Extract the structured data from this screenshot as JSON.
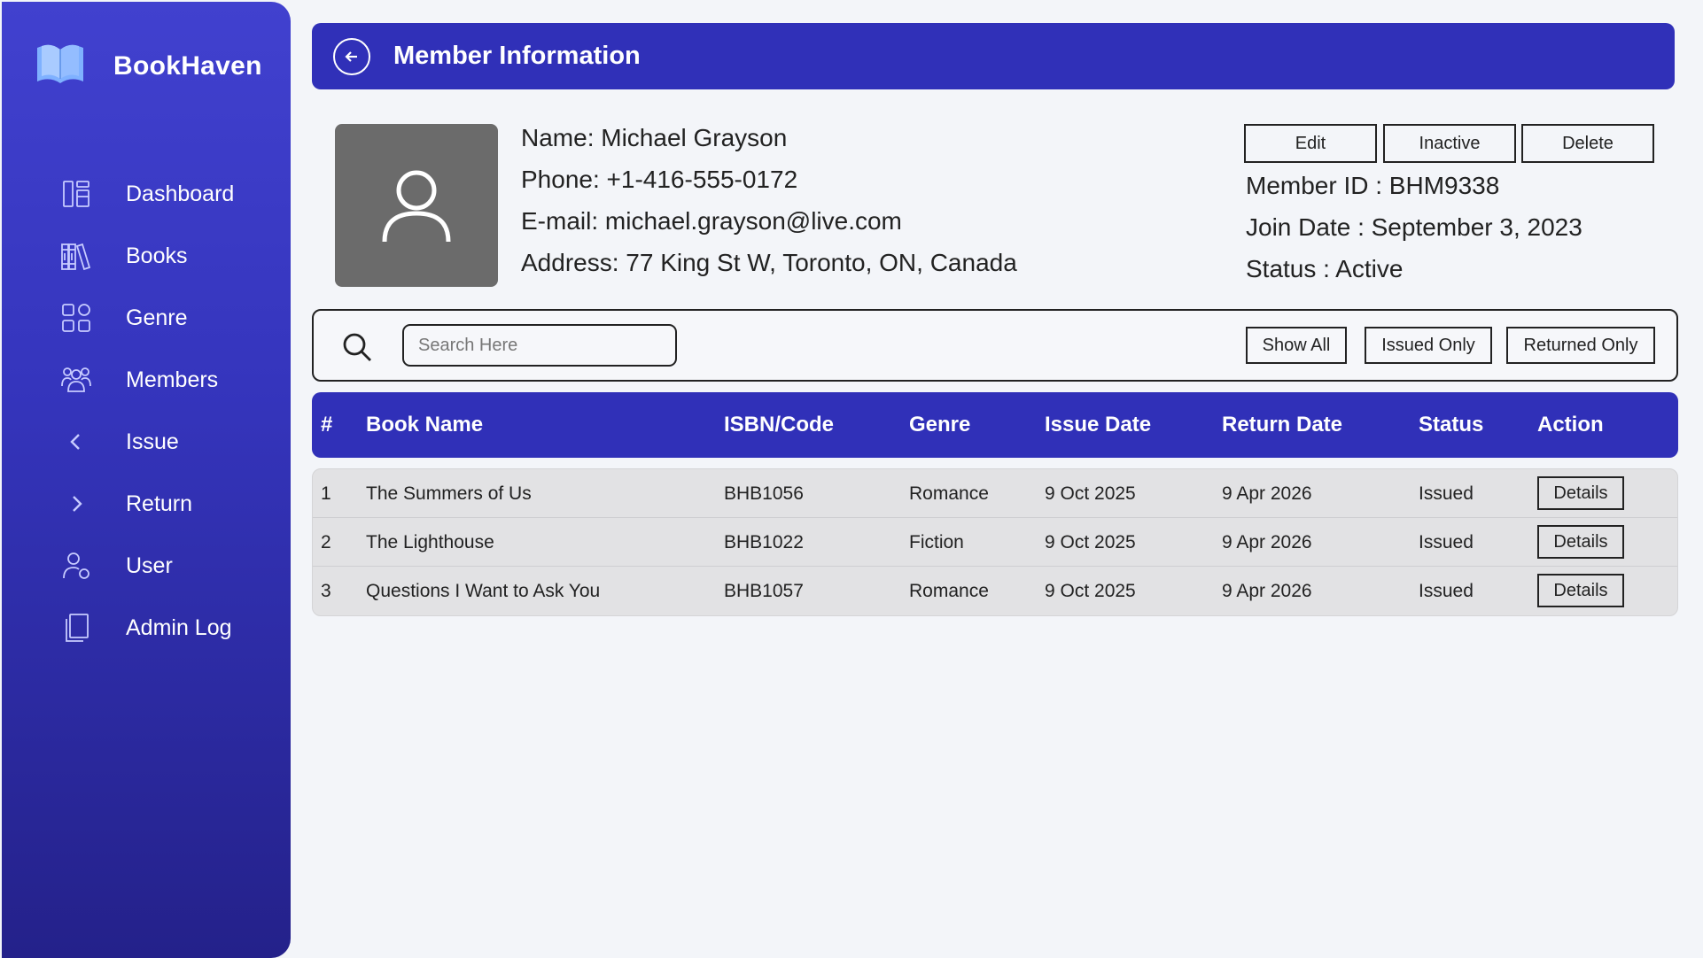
{
  "brand": {
    "name": "BookHaven",
    "logo_icon": "open-book-icon"
  },
  "sidebar": {
    "items": [
      {
        "label": "Dashboard",
        "icon": "dashboard-icon"
      },
      {
        "label": "Books",
        "icon": "books-icon"
      },
      {
        "label": "Genre",
        "icon": "genre-grid-icon"
      },
      {
        "label": "Members",
        "icon": "members-icon"
      },
      {
        "label": "Issue",
        "icon": "chevron-left-icon"
      },
      {
        "label": "Return",
        "icon": "chevron-right-icon"
      },
      {
        "label": "User",
        "icon": "user-icon"
      },
      {
        "label": "Admin Log",
        "icon": "admin-log-icon"
      }
    ]
  },
  "header": {
    "title": "Member Information",
    "back_icon": "back-arrow-icon"
  },
  "member": {
    "name": "Name: Michael Grayson",
    "phone": "Phone: +1-416-555-0172",
    "email": "E-mail: michael.grayson@live.com",
    "address": "Address: 77 King St W, Toronto, ON, Canada",
    "member_id": "Member ID : BHM9338",
    "join_date": "Join Date : September 3, 2023",
    "status": "Status : Active"
  },
  "actions": {
    "edit": "Edit",
    "inactive": "Inactive",
    "delete": "Delete"
  },
  "search": {
    "placeholder": "Search Here",
    "value": ""
  },
  "filters": {
    "show_all": "Show All",
    "issued_only": "Issued Only",
    "returned_only": "Returned Only"
  },
  "table": {
    "headers": [
      "#",
      "Book Name",
      "ISBN/Code",
      "Genre",
      "Issue Date",
      "Return Date",
      "Status",
      "Action"
    ],
    "rows": [
      {
        "num": "1",
        "book": "The Summers of Us",
        "isbn": "BHB1056",
        "genre": "Romance",
        "issue": "9 Oct 2025",
        "return": "9 Apr 2026",
        "status": "Issued",
        "action": "Details"
      },
      {
        "num": "2",
        "book": "The Lighthouse",
        "isbn": "BHB1022",
        "genre": "Fiction",
        "issue": "9 Oct 2025",
        "return": "9 Apr 2026",
        "status": "Issued",
        "action": "Details"
      },
      {
        "num": "3",
        "book": "Questions I Want to Ask You",
        "isbn": "BHB1057",
        "genre": "Romance",
        "issue": "9 Oct 2025",
        "return": "9 Apr 2026",
        "status": "Issued",
        "action": "Details"
      }
    ]
  },
  "colors": {
    "primary": "#3030b8",
    "sidebar_top": "#4141cf",
    "sidebar_bottom": "#24218a",
    "background": "#f3f5f9",
    "row_bg": "#e2e2e4"
  }
}
